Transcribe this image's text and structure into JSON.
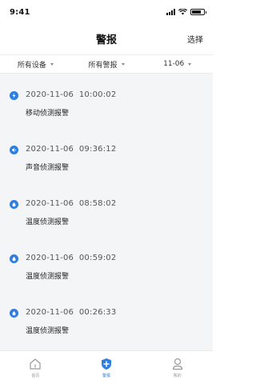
{
  "status_bar": {
    "time": "9:41"
  },
  "header": {
    "title": "警报",
    "action_label": "选择"
  },
  "filters": [
    {
      "label": "所有设备"
    },
    {
      "label": "所有警报"
    },
    {
      "label": "11-06"
    }
  ],
  "alarms": [
    {
      "time": "2020-11-06  10:00:02",
      "title": "移动侦测报警",
      "icon": "motion-alarm-icon"
    },
    {
      "time": "2020-11-06  09:36:12",
      "title": "声音侦测报警",
      "icon": "sound-alarm-icon"
    },
    {
      "time": "2020-11-06  08:58:02",
      "title": "温度侦测报警",
      "icon": "temperature-alarm-icon"
    },
    {
      "time": "2020-11-06  00:59:02",
      "title": "温度侦测报警",
      "icon": "temperature-alarm-icon"
    },
    {
      "time": "2020-11-06  00:26:33",
      "title": "温度侦测报警",
      "icon": "temperature-alarm-icon"
    }
  ],
  "tab_bar": {
    "tabs": [
      {
        "label": "首页",
        "icon": "home-icon",
        "active": false
      },
      {
        "label": "警报",
        "icon": "shield-plus-icon",
        "active": true
      },
      {
        "label": "我的",
        "icon": "user-icon",
        "active": false
      }
    ]
  },
  "colors": {
    "accent": "#2f7de1",
    "background": "#f4f5f7"
  }
}
